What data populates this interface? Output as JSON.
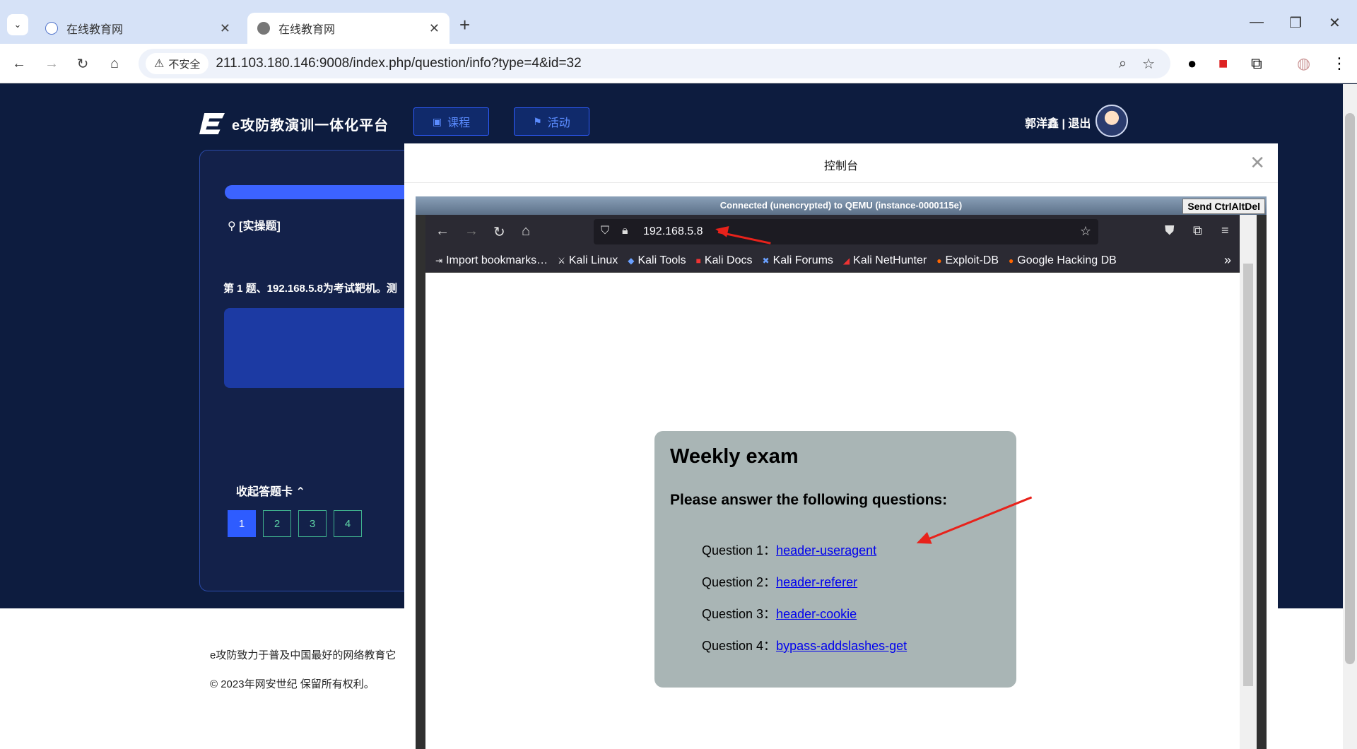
{
  "browser": {
    "tabs": [
      {
        "title": "在线教育网",
        "active": false
      },
      {
        "title": "在线教育网",
        "active": true
      }
    ],
    "security_label": "不安全",
    "url": "211.103.180.146:9008/index.php/question/info?type=4&id=32"
  },
  "site": {
    "logo_text": "e攻防教演训一体化平台",
    "nav": {
      "course": "课程",
      "activity": "活动"
    },
    "user": {
      "name": "郭洋鑫",
      "separator": " | ",
      "logout": "退出"
    }
  },
  "question": {
    "type_label": "[实操题]",
    "text": "第 1 题、192.168.5.8为考试靶机。测",
    "collapse_label": "收起答题卡",
    "numbers": [
      "1",
      "2",
      "3",
      "4"
    ],
    "current": "1"
  },
  "footer": {
    "line1": "e攻防致力于普及中国最好的网络教育它",
    "line2": "© 2023年网安世纪 保留所有权利。"
  },
  "modal": {
    "title": "控制台",
    "vnc_status": "Connected (unencrypted) to QEMU (instance-0000115e)",
    "ctrl_alt_del": "Send CtrlAltDel"
  },
  "firefox": {
    "url": "192.168.5.8",
    "bookmarks": [
      "Import bookmarks…",
      "Kali Linux",
      "Kali Tools",
      "Kali Docs",
      "Kali Forums",
      "Kali NetHunter",
      "Exploit-DB",
      "Google Hacking DB"
    ]
  },
  "exam": {
    "title": "Weekly exam",
    "subtitle": "Please answer the following questions:",
    "questions": [
      {
        "label": "Question 1：",
        "link": "header-useragent"
      },
      {
        "label": "Question 2：",
        "link": "header-referer"
      },
      {
        "label": "Question 3：",
        "link": "header-cookie"
      },
      {
        "label": "Question 4：",
        "link": "bypass-addslashes-get"
      }
    ]
  },
  "colors": {
    "accent": "#2e5cff",
    "page_bg": "#0d1c3f",
    "annotation_arrow": "#e8221b"
  }
}
